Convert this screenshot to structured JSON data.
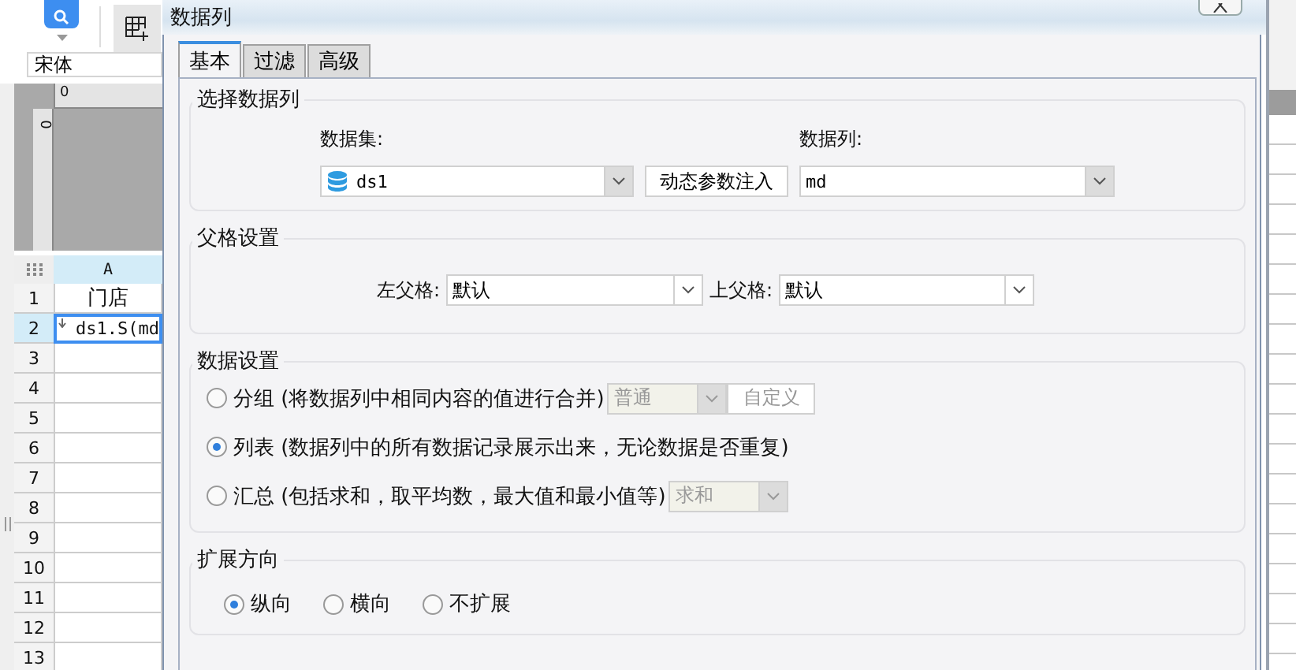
{
  "app": {
    "font_field": {
      "value": "宋体"
    },
    "ruler": {
      "horizontal": "0",
      "vertical": "0"
    },
    "sheet": {
      "columns": [
        "A"
      ],
      "rows": [
        {
          "number": "1",
          "cells": [
            "门店"
          ],
          "selected": false
        },
        {
          "number": "2",
          "cells": [
            "ds1.S(md"
          ],
          "selected": true,
          "expand_mark": true
        },
        {
          "number": "3",
          "selected": false
        },
        {
          "number": "4",
          "selected": false
        },
        {
          "number": "5",
          "selected": false
        },
        {
          "number": "6",
          "selected": false
        },
        {
          "number": "7",
          "selected": false
        },
        {
          "number": "8",
          "selected": false
        },
        {
          "number": "9",
          "selected": false
        },
        {
          "number": "10",
          "selected": false
        },
        {
          "number": "11",
          "selected": false
        },
        {
          "number": "12",
          "selected": false
        },
        {
          "number": "13",
          "selected": false
        }
      ]
    }
  },
  "dialog": {
    "title": "数据列",
    "tabs": [
      {
        "label": "基本",
        "selected": true
      },
      {
        "label": "过滤",
        "selected": false
      },
      {
        "label": "高级",
        "selected": false
      }
    ],
    "dataset_section": {
      "title": "选择数据列",
      "dataset_label": "数据集:",
      "dataset": "ds1",
      "inject_button": "动态参数注入",
      "column_label": "数据列:",
      "column": "md"
    },
    "parent_section": {
      "title": "父格设置",
      "left_label": "左父格:",
      "left": "默认",
      "top_label": "上父格:",
      "top": "默认"
    },
    "data_section": {
      "title": "数据设置",
      "options": [
        {
          "label": "分组 (将数据列中相同内容的值进行合并)",
          "selected": false,
          "controls": [
            {
              "kind": "select",
              "value": "普通",
              "disabled": true
            },
            {
              "kind": "button",
              "label": "自定义",
              "disabled": true
            }
          ]
        },
        {
          "label": "列表 (数据列中的所有数据记录展示出来，无论数据是否重复)",
          "selected": true
        },
        {
          "label": "汇总 (包括求和，取平均数，最大值和最小值等)",
          "selected": false,
          "controls": [
            {
              "kind": "select",
              "value": "求和",
              "disabled": true
            }
          ]
        }
      ]
    },
    "expand_section": {
      "title": "扩展方向",
      "options": [
        {
          "label": "纵向",
          "selected": true
        },
        {
          "label": "横向",
          "selected": false
        },
        {
          "label": "不扩展",
          "selected": false
        }
      ]
    }
  }
}
